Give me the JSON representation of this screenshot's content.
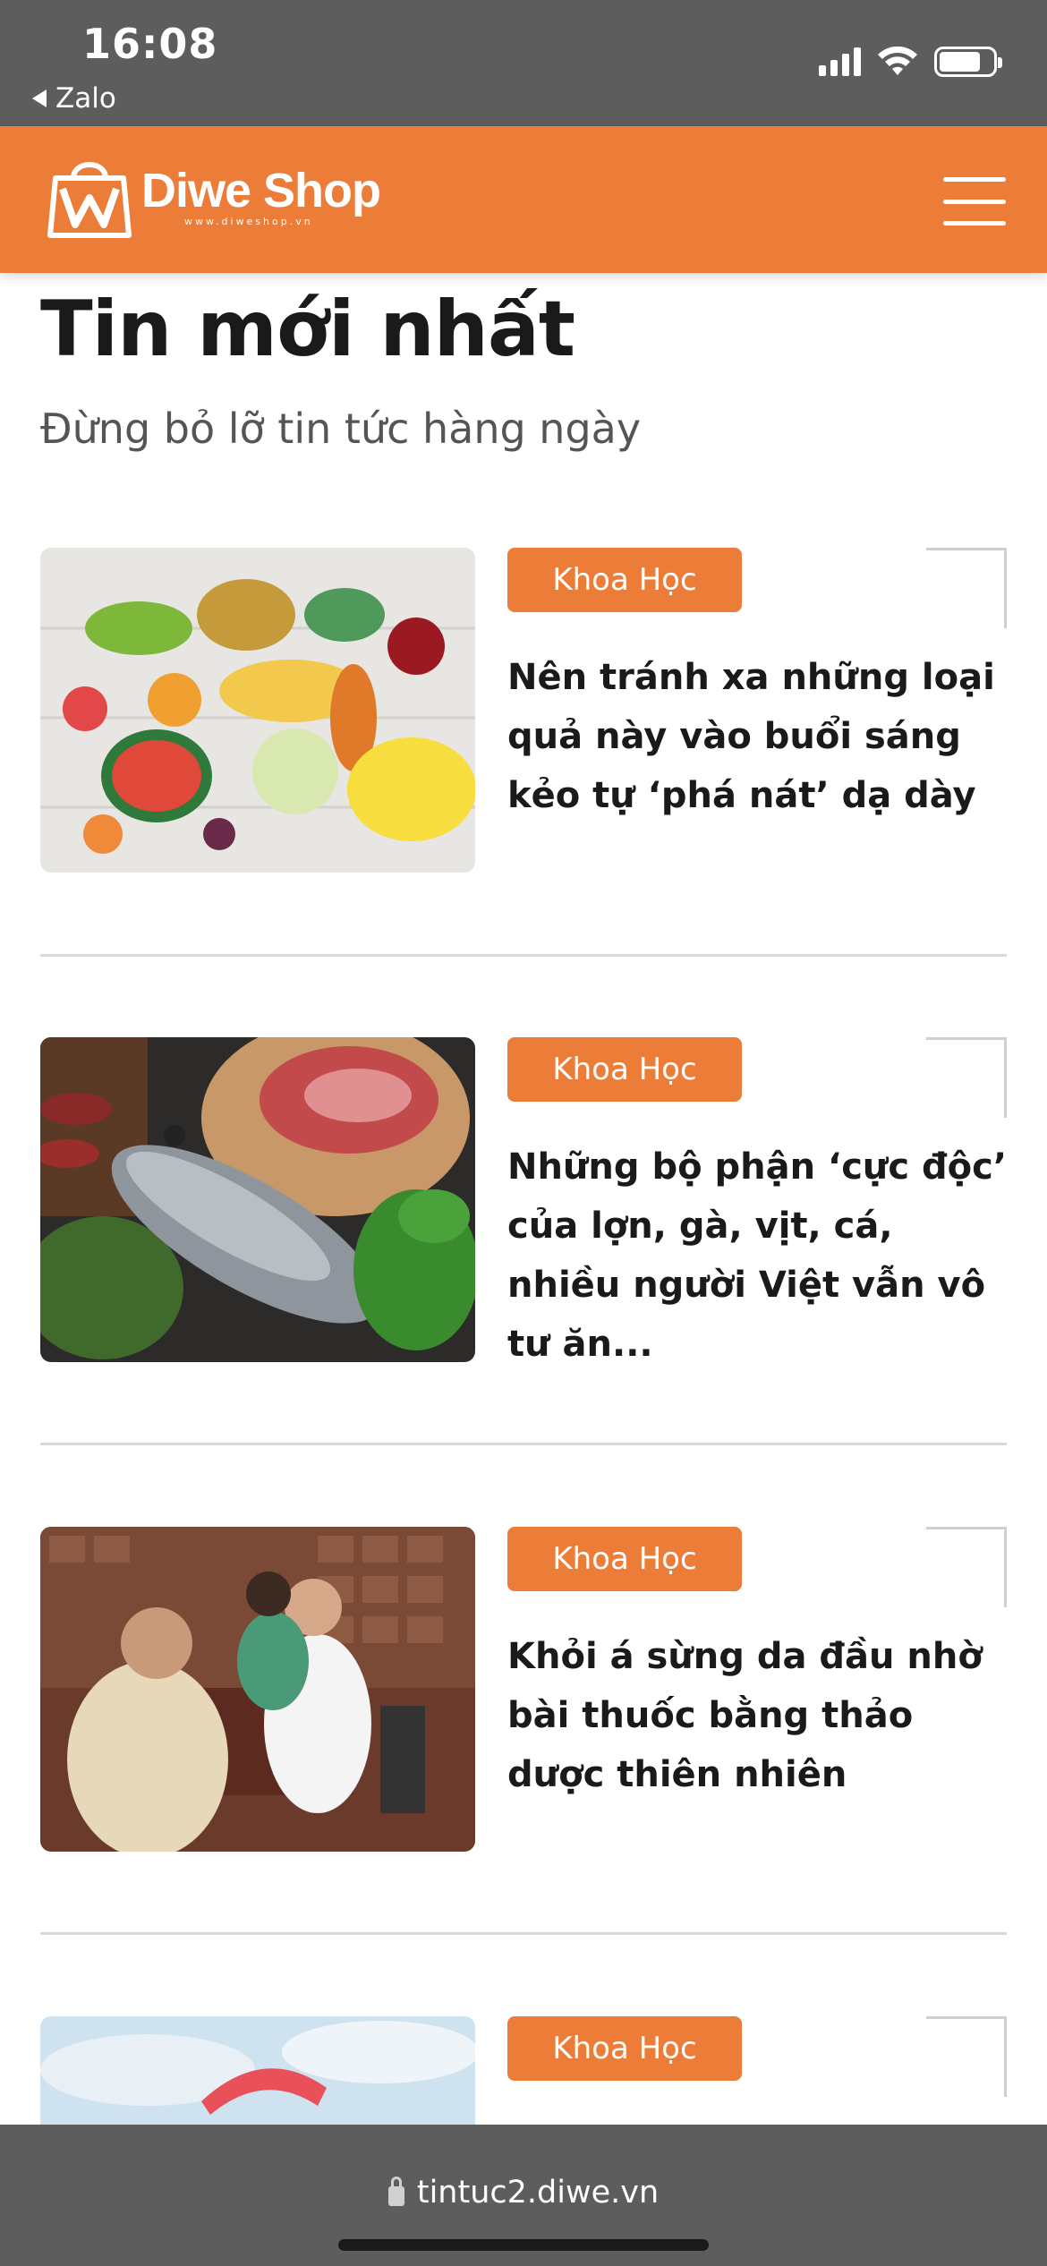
{
  "status_bar": {
    "time": "16:08",
    "back_app": "Zalo",
    "icons": [
      "signal-icon",
      "wifi-icon",
      "battery-icon"
    ]
  },
  "header": {
    "logo_name": "Diwe Shop",
    "logo_sub": "www.diweshop.vn",
    "menu_icon": "hamburger-menu-icon",
    "brand_color": "#ec7d38"
  },
  "section": {
    "title": "Tin mới nhất",
    "subtitle": "Đừng bỏ lỡ tin tức hàng ngày"
  },
  "articles": [
    {
      "category": "Khoa Học",
      "title": "Nên tránh xa những loại quả này vào buổi sáng kẻo tự ‘phá nát’ dạ dày",
      "image": "fruits-image"
    },
    {
      "category": "Khoa Học",
      "title": "Những bộ phận ‘cực độc’ của lợn, gà, vịt, cá, nhiều người Việt vẫn vô tư ăn...",
      "image": "meat-fish-image"
    },
    {
      "category": "Khoa Học",
      "title": "Khỏi á sừng da đầu nhờ bài thuốc bằng thảo dược thiên nhiên",
      "image": "pharmacy-image"
    },
    {
      "category": "Khoa Học",
      "title": "",
      "image": "paraglider-image"
    }
  ],
  "browser": {
    "url": "tintuc2.diwe.vn"
  }
}
